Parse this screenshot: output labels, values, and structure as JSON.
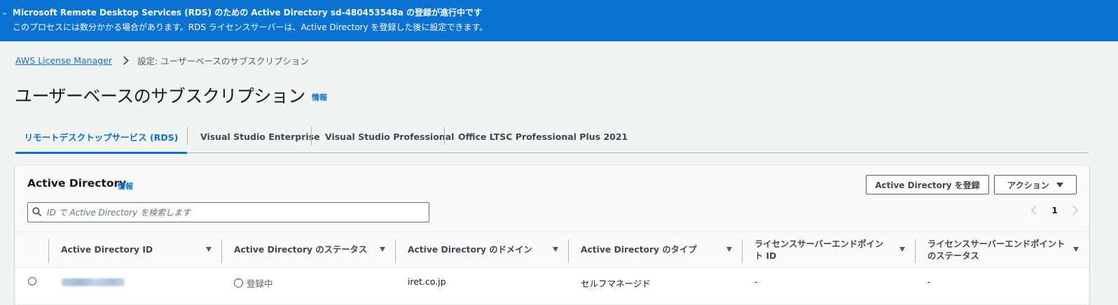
{
  "flash": {
    "title": "Microsoft Remote Desktop Services (RDS) のための Active Directory sd-480453548a の登録が進行中です",
    "message": "このプロセスには数分かかる場合があります。RDS ライセンスサーバーは、Active Directory を登録した後に設定できます。",
    "icon": "chevron-icon",
    "color": "#0972d3"
  },
  "breadcrumb": {
    "root": "AWS License Manager",
    "current": "設定: ユーザーベースのサブスクリプション"
  },
  "page": {
    "title": "ユーザーベースのサブスクリプション",
    "info": "情報"
  },
  "tabs": [
    {
      "label": "リモートデスクトップサービス (RDS)",
      "active": true
    },
    {
      "label": "Visual Studio Enterprise",
      "active": false
    },
    {
      "label": "Visual Studio Professional",
      "active": false
    },
    {
      "label": "Office LTSC Professional Plus 2021",
      "active": false
    }
  ],
  "container": {
    "title": "Active Directory",
    "info": "情報",
    "register_button": "Active Directory を登録",
    "actions_button": "アクション",
    "search_placeholder": "ID で Active Directory を検索します",
    "page_number": "1"
  },
  "table": {
    "columns": [
      "Active Directory ID",
      "Active Directory のステータス",
      "Active Directory のドメイン",
      "Active Directory のタイプ",
      "ライセンスサーバーエンドポイント ID",
      "ライセンスサーバーエンドポイントのステータス"
    ],
    "rows": [
      {
        "status": "登録中",
        "domain": "iret.co.jp",
        "type": "セルフマネージド",
        "endpoint_id": "-",
        "endpoint_status": "-"
      }
    ]
  },
  "accent_color": "#0972d3"
}
